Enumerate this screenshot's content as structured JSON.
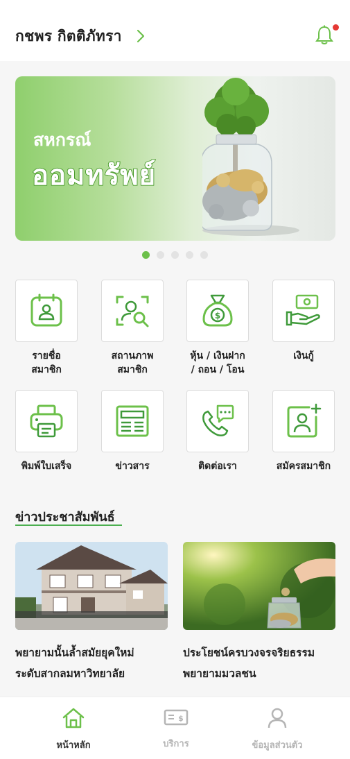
{
  "header": {
    "user_name": "กชพร กิตติภัทรา",
    "notification_dot": true
  },
  "banner": {
    "subtitle": "สหกรณ์",
    "title": "ออมทรัพย์",
    "slides": 5,
    "active_slide": 0
  },
  "menu": [
    {
      "label1": "รายชื่อ",
      "label2": "สมาชิก",
      "icon": "member-list-icon"
    },
    {
      "label1": "สถานภาพ",
      "label2": "สมาชิก",
      "icon": "member-status-icon"
    },
    {
      "label1": "หุ้น / เงินฝาก",
      "label2": "/ ถอน / โอน",
      "icon": "money-bag-icon"
    },
    {
      "label1": "เงินกู้",
      "label2": "",
      "icon": "loan-icon"
    },
    {
      "label1": "พิมพ์ใบเสร็จ",
      "label2": "",
      "icon": "printer-icon"
    },
    {
      "label1": "ข่าวสาร",
      "label2": "",
      "icon": "news-icon"
    },
    {
      "label1": "ติดต่อเรา",
      "label2": "",
      "icon": "contact-icon"
    },
    {
      "label1": "สมัครสมาชิก",
      "label2": "",
      "icon": "register-icon"
    }
  ],
  "news_section": {
    "title": "ข่าวประชาสัมพันธ์",
    "items": [
      {
        "line1": "พยายามนั้นล้ำสมัยยุคใหม่",
        "line2": "ระดับสากลมหาวิทยาลัย"
      },
      {
        "line1": "ประโยชน์ครบวงจรจริยธรรม",
        "line2": "พยายามมวลชน"
      }
    ]
  },
  "bottom_nav": [
    {
      "label": "หน้าหลัก",
      "icon": "home-icon",
      "active": true
    },
    {
      "label": "บริการ",
      "icon": "service-icon",
      "active": false
    },
    {
      "label": "ข้อมูลส่วนตัว",
      "icon": "profile-icon",
      "active": false
    }
  ],
  "colors": {
    "accent": "#6cc04a",
    "accent_dark": "#4caf50",
    "active_tab": "#333333",
    "inactive_tab": "#b5b5b5",
    "badge": "#e53935"
  }
}
